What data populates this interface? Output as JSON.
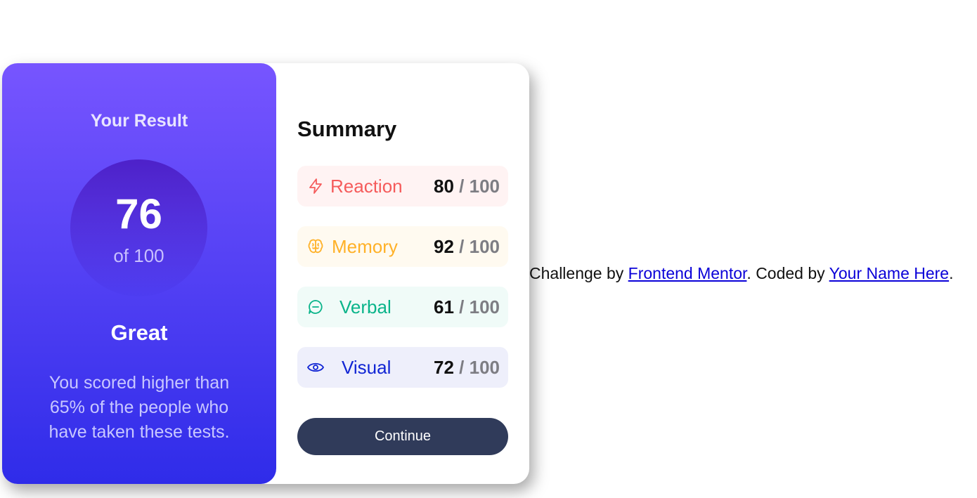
{
  "result": {
    "title": "Your Result",
    "score": "76",
    "max": "of 100",
    "rating": "Great",
    "description": "You scored higher than 65% of the people who have taken these tests."
  },
  "summary": {
    "title": "Summary",
    "items": [
      {
        "label": "Reaction",
        "score": "80",
        "slash": " / ",
        "max": "100",
        "icon": "lightning-icon",
        "color": "#f55b5b"
      },
      {
        "label": "Memory",
        "score": "92",
        "slash": " / ",
        "max": "100",
        "icon": "brain-icon",
        "color": "#ffb128"
      },
      {
        "label": "Verbal",
        "score": "61",
        "slash": " / ",
        "max": "100",
        "icon": "chat-bubble-icon",
        "color": "#0ab48a"
      },
      {
        "label": "Visual",
        "score": "72",
        "slash": " / ",
        "max": "100",
        "icon": "eye-icon",
        "color": "#1125d4"
      }
    ],
    "continue_label": "Continue"
  },
  "attribution": {
    "prefix": "Challenge by ",
    "link1": "Frontend Mentor",
    "middle": ". Coded by ",
    "link2": "Your Name Here",
    "suffix": "."
  },
  "colors": {
    "gradient_top": "#7755ff",
    "gradient_bottom": "#2f2ce9",
    "button": "#303b5a"
  }
}
